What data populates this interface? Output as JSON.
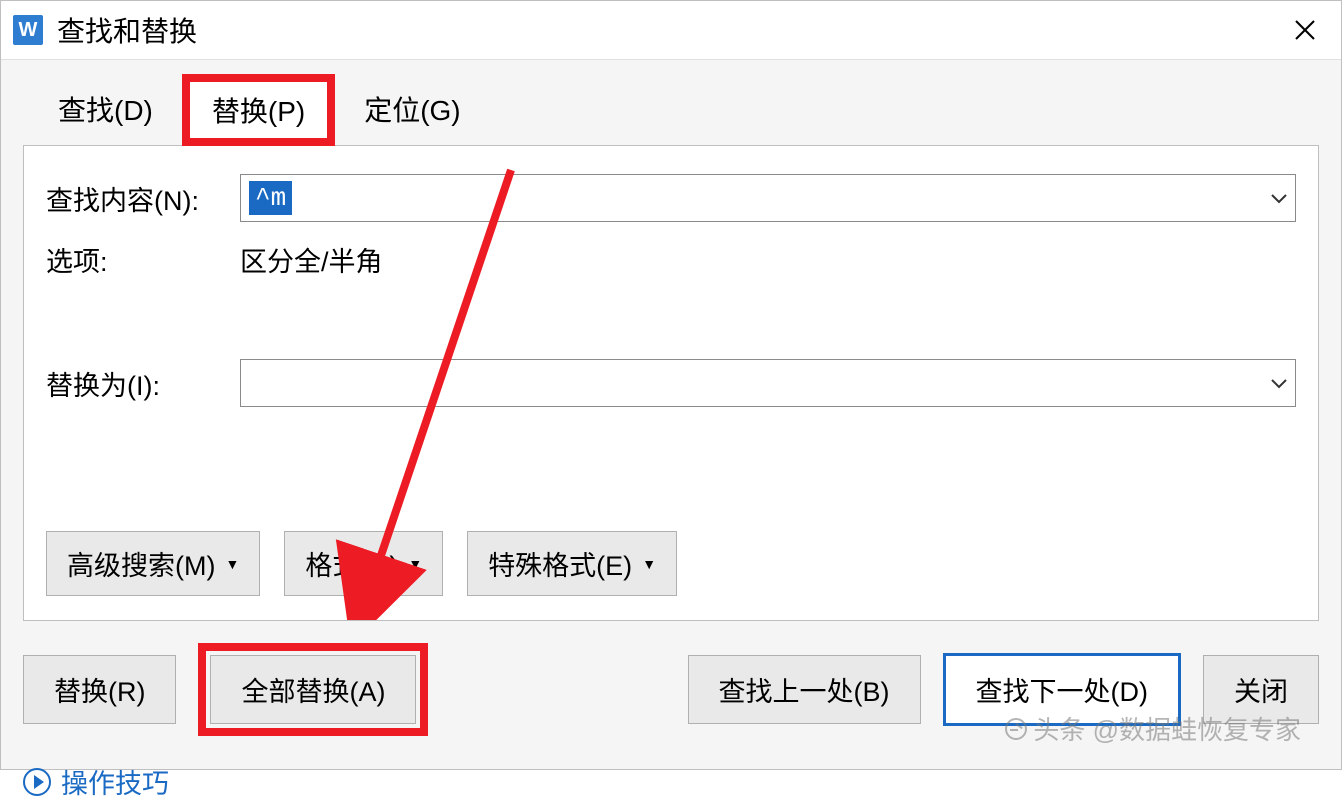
{
  "window": {
    "title": "查找和替换",
    "app_icon_letter": "W"
  },
  "tabs": {
    "find": "查找(D)",
    "replace": "替换(P)",
    "goto": "定位(G)"
  },
  "fields": {
    "find_label": "查找内容(N):",
    "find_value": "^m",
    "options_label": "选项:",
    "options_value": "区分全/半角",
    "replace_label": "替换为(I):",
    "replace_value": ""
  },
  "dropdowns": {
    "advanced": "高级搜索(M)",
    "format": "格式(O)",
    "special": "特殊格式(E)"
  },
  "buttons": {
    "replace": "替换(R)",
    "replace_all": "全部替换(A)",
    "find_prev": "查找上一处(B)",
    "find_next": "查找下一处(D)",
    "close": "关闭"
  },
  "tips": {
    "label": "操作技巧"
  },
  "watermark": {
    "text": "头条 @数据蛙恢复专家"
  }
}
